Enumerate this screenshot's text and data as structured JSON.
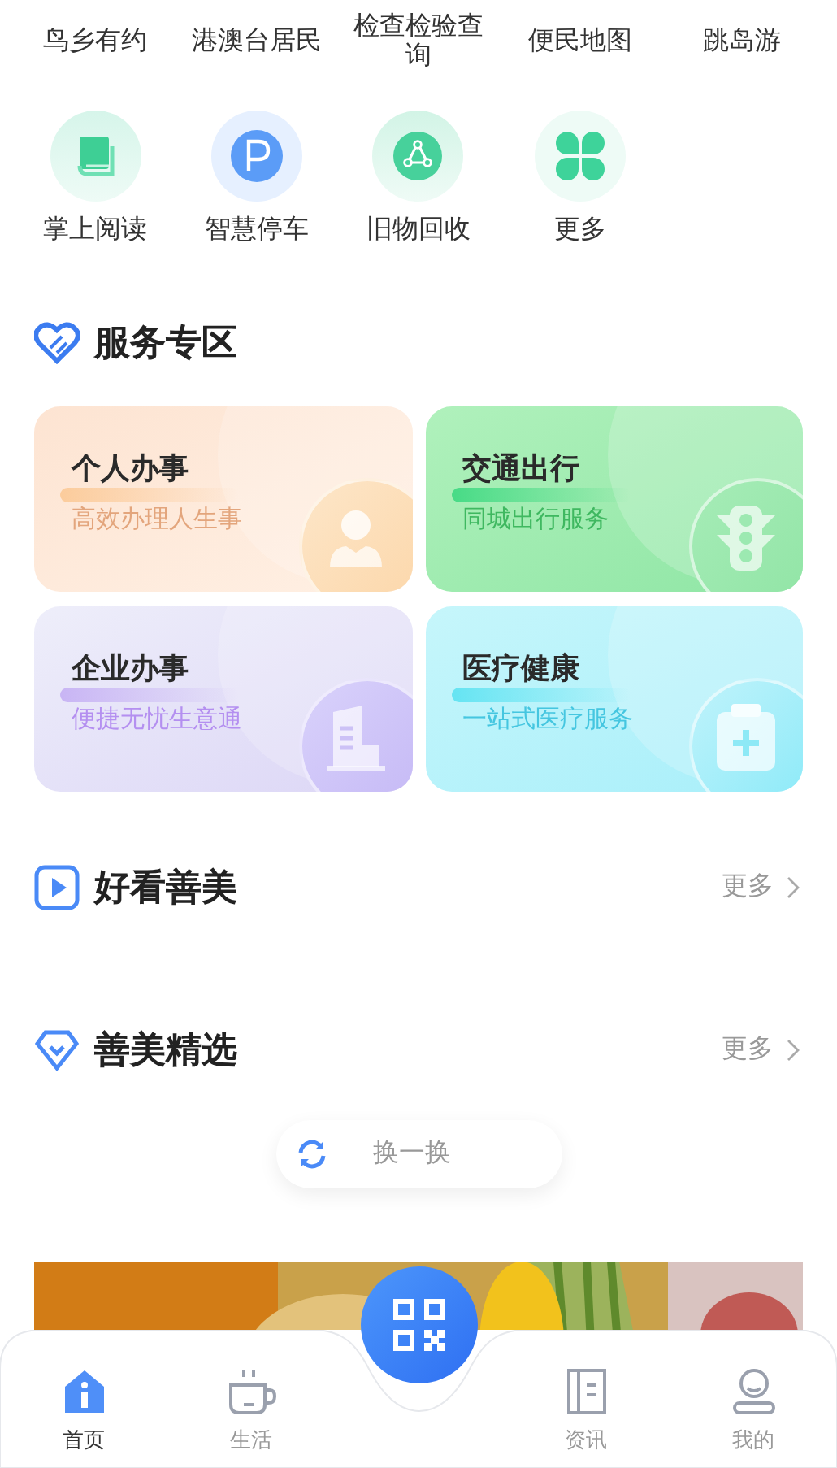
{
  "quick_links_top": [
    {
      "label": "鸟乡有约"
    },
    {
      "label": "港澳台居民"
    },
    {
      "label": "检查检验查询"
    },
    {
      "label": "便民地图"
    },
    {
      "label": "跳岛游"
    }
  ],
  "quick_links": [
    {
      "label": "掌上阅读",
      "kind": "book"
    },
    {
      "label": "智慧停车",
      "kind": "parking"
    },
    {
      "label": "旧物回收",
      "kind": "recycle"
    },
    {
      "label": "更多",
      "kind": "more"
    }
  ],
  "service_section": {
    "title": "服务专区",
    "cards": [
      {
        "title": "个人办事",
        "subtitle": "高效办理人生事",
        "kind": "personal"
      },
      {
        "title": "交通出行",
        "subtitle": "同城出行服务",
        "kind": "traffic"
      },
      {
        "title": "企业办事",
        "subtitle": "便捷无忧生意通",
        "kind": "business"
      },
      {
        "title": "医疗健康",
        "subtitle": "一站式医疗服务",
        "kind": "medical"
      }
    ]
  },
  "video_section": {
    "title": "好看善美",
    "more": "更多"
  },
  "picks_section": {
    "title": "善美精选",
    "more": "更多",
    "refresh": "换一换"
  },
  "tab_bar": {
    "tabs": [
      {
        "label": "首页",
        "kind": "home",
        "selected": true
      },
      {
        "label": "生活",
        "kind": "cup",
        "selected": false
      },
      {
        "label": "资讯",
        "kind": "news",
        "selected": false
      },
      {
        "label": "我的",
        "kind": "user",
        "selected": false
      }
    ]
  }
}
